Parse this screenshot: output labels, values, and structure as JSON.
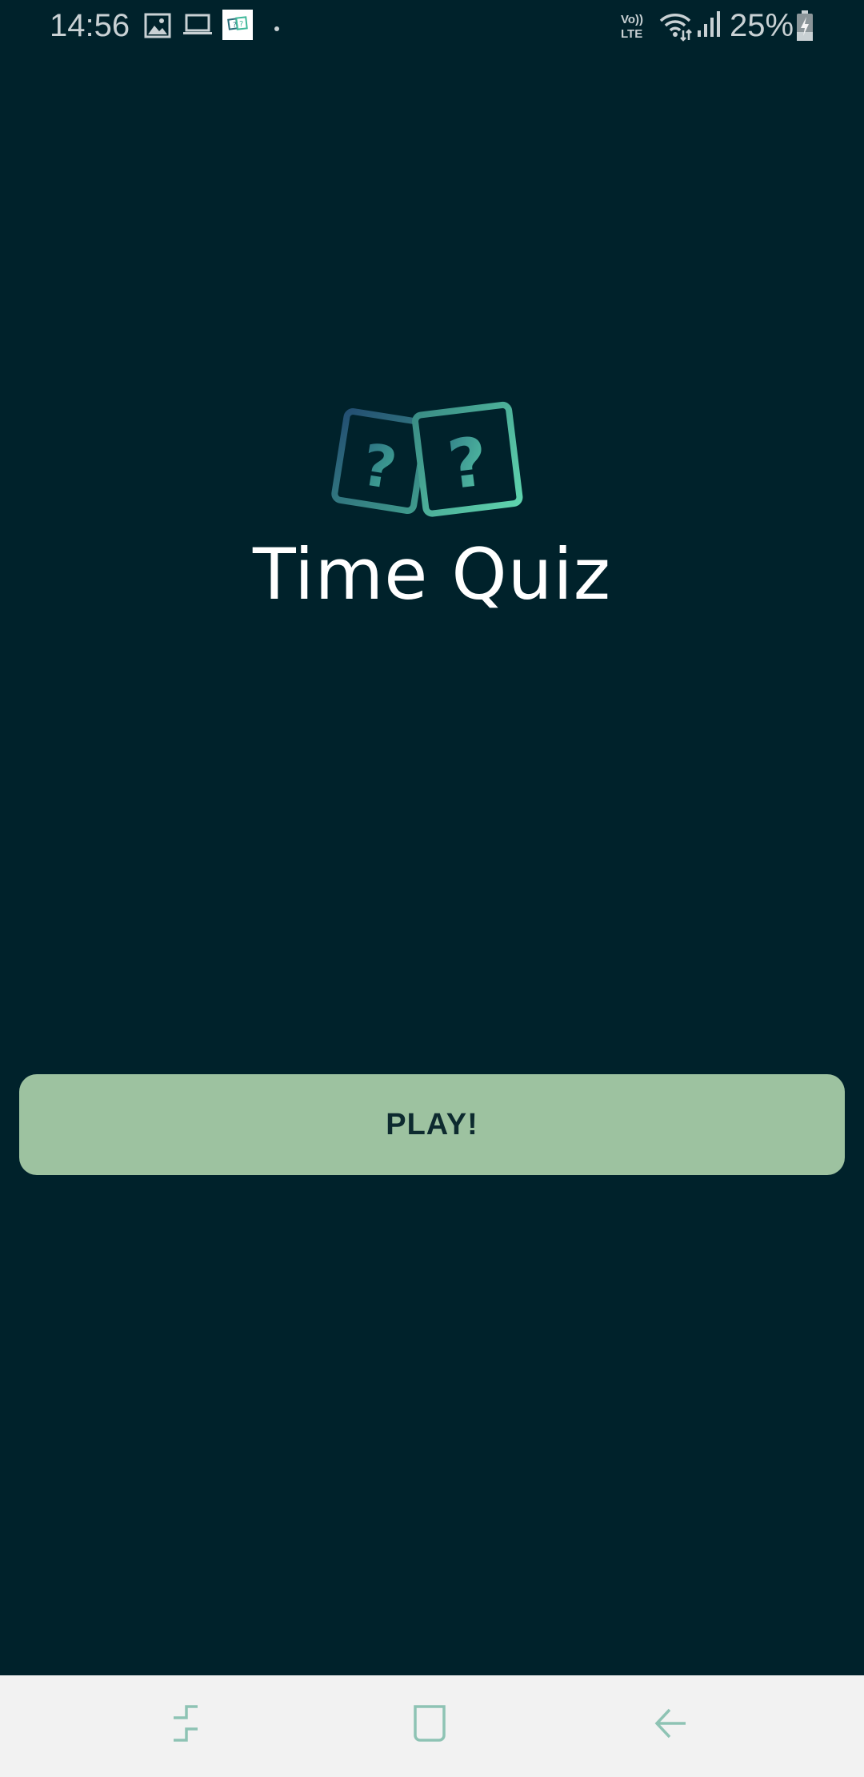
{
  "status_bar": {
    "time": "14:56",
    "battery": "25%",
    "icons": [
      "gallery-icon",
      "laptop-icon",
      "app-notification-icon",
      "dot-icon",
      "volte-icon",
      "wifi-icon",
      "signal-icon",
      "battery-charging-icon"
    ],
    "volte_label_top": "Vo))",
    "volte_label_bottom": "LTE"
  },
  "app": {
    "title": "Time Quiz",
    "logo_icon": "question-cards-icon",
    "play_label": "PLAY!"
  },
  "colors": {
    "background": "#00222b",
    "button": "#9dc2a0",
    "button_text": "#0d2a2f",
    "title": "#ffffff",
    "nav_bar": "#f2f2f2",
    "nav_icon": "#8ec3b4"
  },
  "nav_bar": {
    "icons": [
      "recent-apps-icon",
      "home-icon",
      "back-icon"
    ]
  }
}
